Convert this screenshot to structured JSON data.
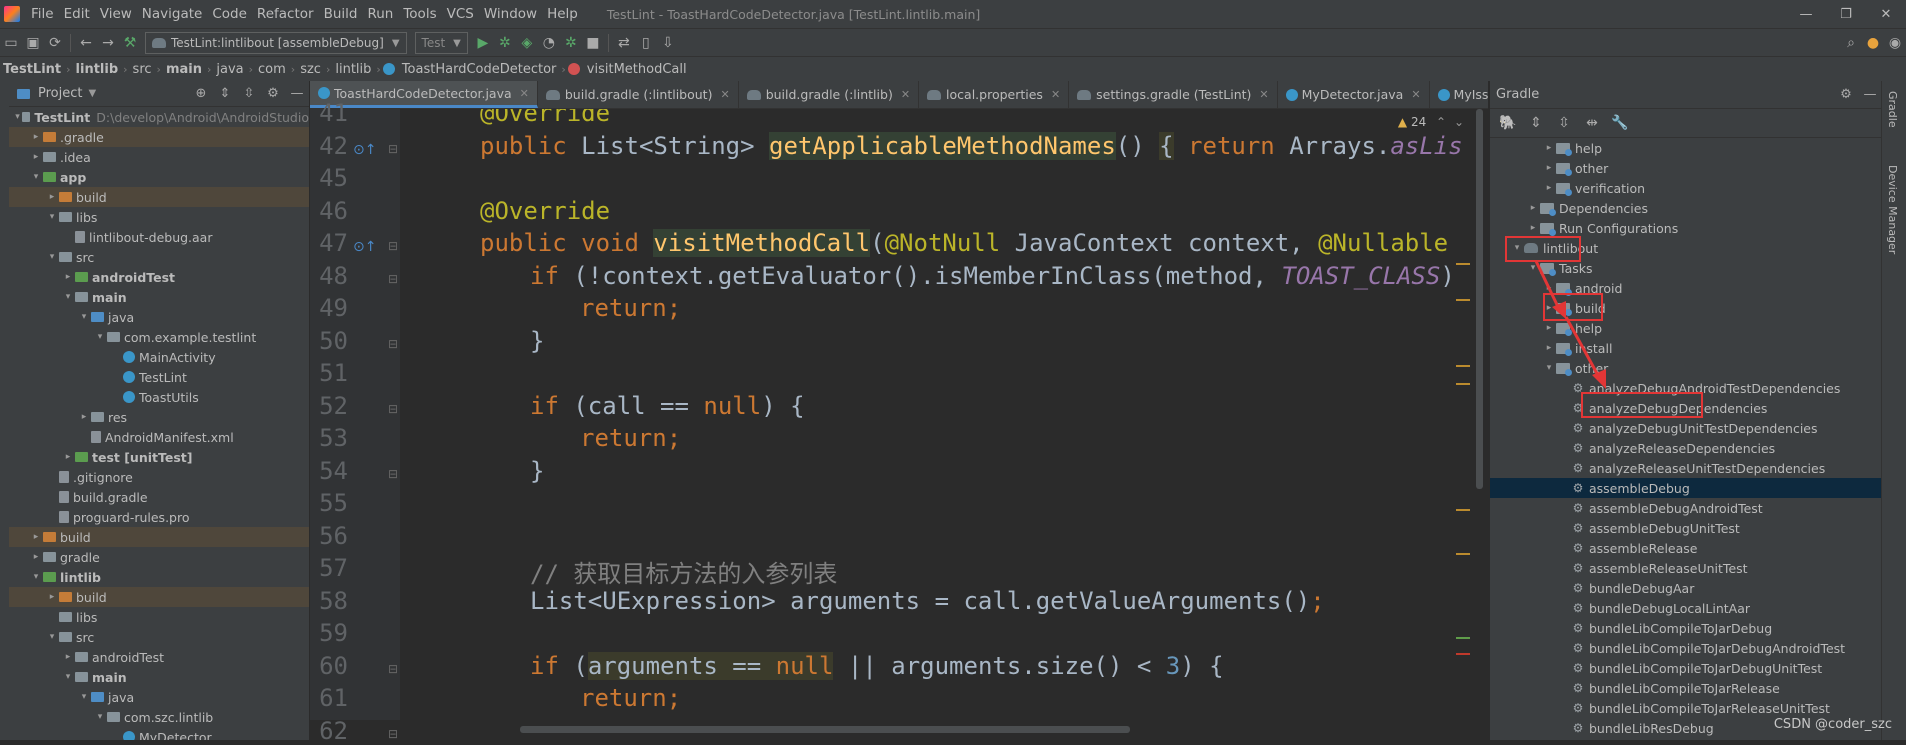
{
  "menubar": {
    "items": [
      "File",
      "Edit",
      "View",
      "Navigate",
      "Code",
      "Refactor",
      "Build",
      "Run",
      "Tools",
      "VCS",
      "Window",
      "Help"
    ],
    "window_title": "TestLint - ToastHardCodeDetector.java [TestLint.lintlib.main]"
  },
  "toolbar": {
    "run_config": "TestLint:lintlibout [assembleDebug]",
    "device": "Test"
  },
  "breadcrumb": [
    "TestLint",
    "lintlib",
    "src",
    "main",
    "java",
    "com",
    "szc",
    "lintlib",
    "ToastHardCodeDetector",
    "visitMethodCall"
  ],
  "project": {
    "title": "Project",
    "rows": [
      {
        "text": "TestLint",
        "extra": "D:\\develop\\Android\\AndroidStudio",
        "indent": 0,
        "arrow": "▾",
        "icon": "folder",
        "bold": true
      },
      {
        "text": ".gradle",
        "indent": 1,
        "arrow": "▸",
        "icon": "folder-orange",
        "bg": "orange"
      },
      {
        "text": ".idea",
        "indent": 1,
        "arrow": "▸",
        "icon": "folder"
      },
      {
        "text": "app",
        "indent": 1,
        "arrow": "▾",
        "icon": "folder-green",
        "bold": true
      },
      {
        "text": "build",
        "indent": 2,
        "arrow": "▸",
        "icon": "folder-orange",
        "bg": "orange"
      },
      {
        "text": "libs",
        "indent": 2,
        "arrow": "▾",
        "icon": "folder"
      },
      {
        "text": "lintlibout-debug.aar",
        "indent": 3,
        "arrow": "",
        "icon": "file"
      },
      {
        "text": "src",
        "indent": 2,
        "arrow": "▾",
        "icon": "folder"
      },
      {
        "text": "androidTest",
        "indent": 3,
        "arrow": "▸",
        "icon": "folder-green",
        "bold": true
      },
      {
        "text": "main",
        "indent": 3,
        "arrow": "▾",
        "icon": "folder",
        "bold": true
      },
      {
        "text": "java",
        "indent": 4,
        "arrow": "▾",
        "icon": "folder-blue"
      },
      {
        "text": "com.example.testlint",
        "indent": 5,
        "arrow": "▾",
        "icon": "folder"
      },
      {
        "text": "MainActivity",
        "indent": 6,
        "arrow": "",
        "icon": "class"
      },
      {
        "text": "TestLint",
        "indent": 6,
        "arrow": "",
        "icon": "class"
      },
      {
        "text": "ToastUtils",
        "indent": 6,
        "arrow": "",
        "icon": "class"
      },
      {
        "text": "res",
        "indent": 4,
        "arrow": "▸",
        "icon": "folder"
      },
      {
        "text": "AndroidManifest.xml",
        "indent": 4,
        "arrow": "",
        "icon": "file"
      },
      {
        "text": "test [unitTest]",
        "indent": 3,
        "arrow": "▸",
        "icon": "folder-green",
        "bold": true
      },
      {
        "text": ".gitignore",
        "indent": 2,
        "arrow": "",
        "icon": "file"
      },
      {
        "text": "build.gradle",
        "indent": 2,
        "arrow": "",
        "icon": "file"
      },
      {
        "text": "proguard-rules.pro",
        "indent": 2,
        "arrow": "",
        "icon": "file"
      },
      {
        "text": "build",
        "indent": 1,
        "arrow": "▸",
        "icon": "folder-orange",
        "bg": "orange"
      },
      {
        "text": "gradle",
        "indent": 1,
        "arrow": "▸",
        "icon": "folder"
      },
      {
        "text": "lintlib",
        "indent": 1,
        "arrow": "▾",
        "icon": "folder-green",
        "bold": true
      },
      {
        "text": "build",
        "indent": 2,
        "arrow": "▸",
        "icon": "folder-orange",
        "bg": "orange"
      },
      {
        "text": "libs",
        "indent": 2,
        "arrow": "",
        "icon": "folder"
      },
      {
        "text": "src",
        "indent": 2,
        "arrow": "▾",
        "icon": "folder"
      },
      {
        "text": "androidTest",
        "indent": 3,
        "arrow": "▸",
        "icon": "folder"
      },
      {
        "text": "main",
        "indent": 3,
        "arrow": "▾",
        "icon": "folder",
        "bold": true
      },
      {
        "text": "java",
        "indent": 4,
        "arrow": "▾",
        "icon": "folder-blue"
      },
      {
        "text": "com.szc.lintlib",
        "indent": 5,
        "arrow": "▾",
        "icon": "folder"
      },
      {
        "text": "MyDetector",
        "indent": 6,
        "arrow": "",
        "icon": "class"
      }
    ]
  },
  "tabs": [
    {
      "label": "ToastHardCodeDetector.java",
      "active": true
    },
    {
      "label": "build.gradle (:lintlibout)"
    },
    {
      "label": "build.gradle (:lintlib)"
    },
    {
      "label": "local.properties"
    },
    {
      "label": "settings.gradle (TestLint)"
    },
    {
      "label": "MyDetector.java"
    },
    {
      "label": "MyIssu"
    }
  ],
  "editor": {
    "warning_count": "24",
    "lines": [
      {
        "n": "41",
        "html": "<span class='an'>@Override</span>",
        "indent": 1
      },
      {
        "n": "42",
        "html": "<span class='kw'>public </span>List&lt;String&gt; <span class='fnhl'>getApplicableMethodNames</span>() <span class='hl'>{</span> <span class='kw'>return </span>Arrays.<span class='st'>asLis</span>",
        "indent": 1
      },
      {
        "n": "45",
        "html": "",
        "indent": 0
      },
      {
        "n": "46",
        "html": "<span class='an'>@Override</span>",
        "indent": 1
      },
      {
        "n": "47",
        "html": "<span class='kw'>public void </span><span class='fnhl'>visitMethodCall</span>(<span class='an'>@NotNull </span>JavaContext context, <span class='an'>@Nullable</span>",
        "indent": 1
      },
      {
        "n": "48",
        "html": "<span class='kw'>if </span>(!context.getEvaluator().isMemberInClass(method, <span class='st'>TOAST_CLASS</span>)",
        "indent": 2
      },
      {
        "n": "49",
        "html": "<span class='kw'>return;</span>",
        "indent": 3
      },
      {
        "n": "50",
        "html": "}",
        "indent": 2
      },
      {
        "n": "51",
        "html": "",
        "indent": 0
      },
      {
        "n": "52",
        "html": "<span class='kw'>if </span>(call == <span class='kw'>null</span>) {",
        "indent": 2
      },
      {
        "n": "53",
        "html": "<span class='kw'>return;</span>",
        "indent": 3
      },
      {
        "n": "54",
        "html": "}",
        "indent": 2
      },
      {
        "n": "55",
        "html": "",
        "indent": 0
      },
      {
        "n": "56",
        "html": "",
        "indent": 0
      },
      {
        "n": "57",
        "html": "<span class='cm'>// 获取目标方法的入参列表</span>",
        "indent": 2
      },
      {
        "n": "58",
        "html": "List&lt;UExpression&gt; arguments = call.getValueArguments()<span class='kw'>;</span>",
        "indent": 2
      },
      {
        "n": "59",
        "html": "",
        "indent": 0
      },
      {
        "n": "60",
        "html": "<span class='kw'>if </span>(<span class='hl'>arguments == <span class='kw'>null</span></span> || arguments.size() &lt; <span class='nm'>3</span>) {",
        "indent": 2
      },
      {
        "n": "61",
        "html": "<span class='kw'>return;</span>",
        "indent": 3
      },
      {
        "n": "62",
        "html": "}",
        "indent": 2
      }
    ]
  },
  "gradle": {
    "title": "Gradle",
    "rows": [
      {
        "text": "help",
        "indent": 3,
        "arrow": "▸",
        "icon": "folder"
      },
      {
        "text": "other",
        "indent": 3,
        "arrow": "▸",
        "icon": "folder"
      },
      {
        "text": "verification",
        "indent": 3,
        "arrow": "▸",
        "icon": "folder"
      },
      {
        "text": "Dependencies",
        "indent": 2,
        "arrow": "▸",
        "icon": "folder"
      },
      {
        "text": "Run Configurations",
        "indent": 2,
        "arrow": "▸",
        "icon": "folder"
      },
      {
        "text": "lintlibout",
        "indent": 1,
        "arrow": "▾",
        "icon": "elephant"
      },
      {
        "text": "Tasks",
        "indent": 2,
        "arrow": "▾",
        "icon": "folder"
      },
      {
        "text": "android",
        "indent": 3,
        "arrow": "▸",
        "icon": "folder"
      },
      {
        "text": "build",
        "indent": 3,
        "arrow": "▸",
        "icon": "folder"
      },
      {
        "text": "help",
        "indent": 3,
        "arrow": "▸",
        "icon": "folder"
      },
      {
        "text": "install",
        "indent": 3,
        "arrow": "▸",
        "icon": "folder"
      },
      {
        "text": "other",
        "indent": 3,
        "arrow": "▾",
        "icon": "folder"
      },
      {
        "text": "analyzeDebugAndroidTestDependencies",
        "indent": 4,
        "icon": "gear"
      },
      {
        "text": "analyzeDebugDependencies",
        "indent": 4,
        "icon": "gear"
      },
      {
        "text": "analyzeDebugUnitTestDependencies",
        "indent": 4,
        "icon": "gear"
      },
      {
        "text": "analyzeReleaseDependencies",
        "indent": 4,
        "icon": "gear"
      },
      {
        "text": "analyzeReleaseUnitTestDependencies",
        "indent": 4,
        "icon": "gear"
      },
      {
        "text": "assembleDebug",
        "indent": 4,
        "icon": "gear",
        "selected": true
      },
      {
        "text": "assembleDebugAndroidTest",
        "indent": 4,
        "icon": "gear"
      },
      {
        "text": "assembleDebugUnitTest",
        "indent": 4,
        "icon": "gear"
      },
      {
        "text": "assembleRelease",
        "indent": 4,
        "icon": "gear"
      },
      {
        "text": "assembleReleaseUnitTest",
        "indent": 4,
        "icon": "gear"
      },
      {
        "text": "bundleDebugAar",
        "indent": 4,
        "icon": "gear"
      },
      {
        "text": "bundleDebugLocalLintAar",
        "indent": 4,
        "icon": "gear"
      },
      {
        "text": "bundleLibCompileToJarDebug",
        "indent": 4,
        "icon": "gear"
      },
      {
        "text": "bundleLibCompileToJarDebugAndroidTest",
        "indent": 4,
        "icon": "gear"
      },
      {
        "text": "bundleLibCompileToJarDebugUnitTest",
        "indent": 4,
        "icon": "gear"
      },
      {
        "text": "bundleLibCompileToJarRelease",
        "indent": 4,
        "icon": "gear"
      },
      {
        "text": "bundleLibCompileToJarReleaseUnitTest",
        "indent": 4,
        "icon": "gear"
      },
      {
        "text": "bundleLibResDebug",
        "indent": 4,
        "icon": "gear"
      }
    ]
  },
  "right_strip": {
    "gradle": "Gradle",
    "device_manager": "Device Manager"
  },
  "watermark": "CSDN @coder_szc",
  "colors": {
    "highlight_box": "#e23636",
    "selection": "#0d293e"
  }
}
